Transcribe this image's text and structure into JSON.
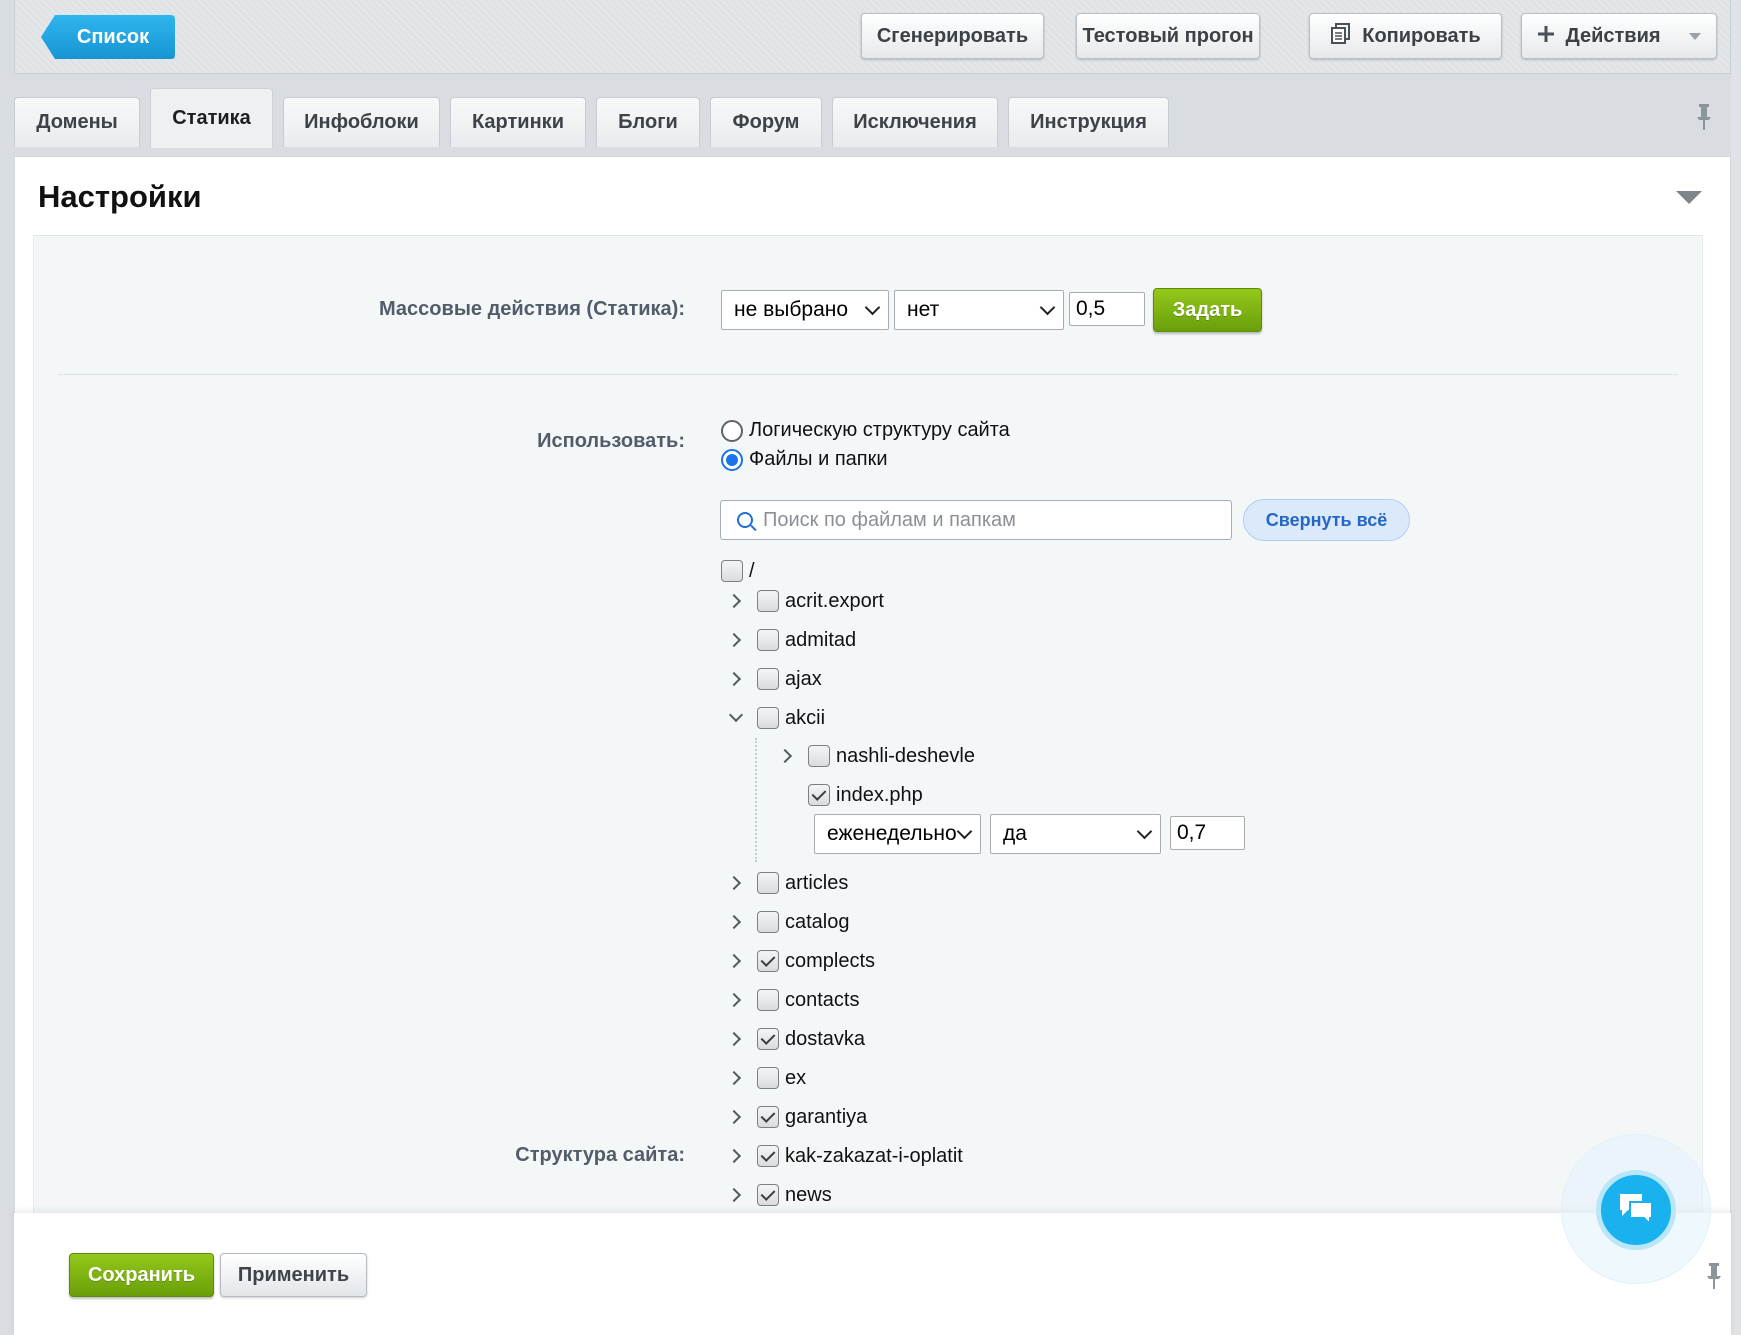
{
  "toolbar": {
    "list_label": "Список",
    "generate_label": "Сгенерировать",
    "test_run_label": "Тестовый прогон",
    "copy_label": "Копировать",
    "actions_label": "Действия"
  },
  "tabs": [
    {
      "label": "Домены",
      "active": false
    },
    {
      "label": "Статика",
      "active": true
    },
    {
      "label": "Инфоблоки",
      "active": false
    },
    {
      "label": "Картинки",
      "active": false
    },
    {
      "label": "Блоги",
      "active": false
    },
    {
      "label": "Форум",
      "active": false
    },
    {
      "label": "Исключения",
      "active": false
    },
    {
      "label": "Инструкция",
      "active": false
    }
  ],
  "section": {
    "title": "Настройки"
  },
  "mass_actions": {
    "label": "Массовые действия (Статика):",
    "frequency_value": "не выбрано",
    "active_value": "нет",
    "priority_value": "0,5",
    "apply_label": "Задать"
  },
  "use_source": {
    "label": "Использовать:",
    "options": [
      {
        "label": "Логическую структуру сайта",
        "checked": false
      },
      {
        "label": "Файлы и папки",
        "checked": true
      }
    ]
  },
  "search": {
    "placeholder": "Поиск по файлам и папкам",
    "collapse_all_label": "Свернуть всё"
  },
  "structure": {
    "label": "Структура сайта:",
    "root_label": "/",
    "items": [
      {
        "label": "acrit.export",
        "checked": false
      },
      {
        "label": "admitad",
        "checked": false
      },
      {
        "label": "ajax",
        "checked": false
      },
      {
        "label": "akcii",
        "checked": false,
        "expanded": true
      },
      {
        "label": "articles",
        "checked": false
      },
      {
        "label": "catalog",
        "checked": false
      },
      {
        "label": "complects",
        "checked": true
      },
      {
        "label": "contacts",
        "checked": false
      },
      {
        "label": "dostavka",
        "checked": true
      },
      {
        "label": "ex",
        "checked": false
      },
      {
        "label": "garantiya",
        "checked": true
      },
      {
        "label": "kak-zakazat-i-oplatit",
        "checked": true
      },
      {
        "label": "news",
        "checked": true
      }
    ],
    "akcii_children": [
      {
        "label": "nashli-deshevle",
        "checked": false,
        "folder": true
      },
      {
        "label": "index.php",
        "checked": true,
        "folder": false
      }
    ],
    "index_settings": {
      "frequency_value": "еженедельно",
      "active_value": "да",
      "priority_value": "0,7"
    }
  },
  "footer": {
    "save_label": "Сохранить",
    "apply_label": "Применить"
  },
  "colors": {
    "accent_blue": "#1795d3",
    "green_button": "#7cb313",
    "chat_blue": "#1ab2ee"
  }
}
